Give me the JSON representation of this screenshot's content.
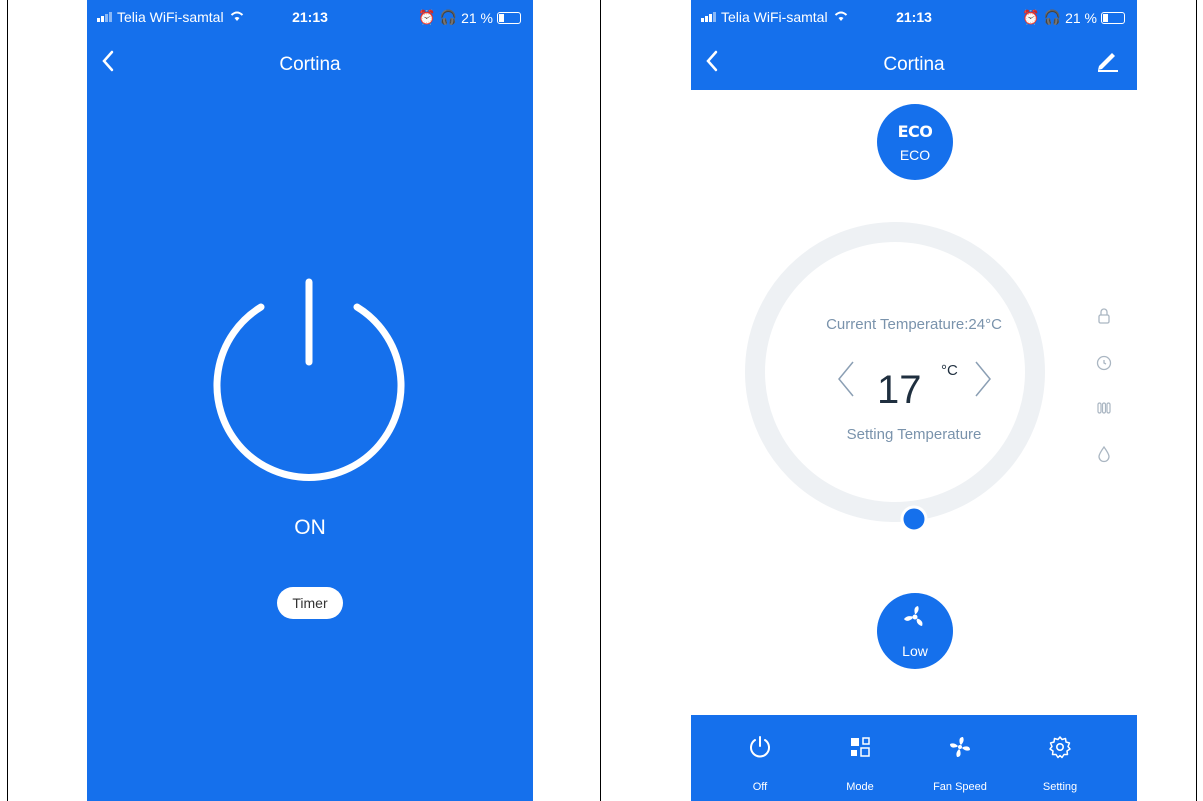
{
  "left_screen": {
    "status": {
      "carrier": "Telia WiFi-samtal",
      "time": "21:13",
      "battery": "21 %"
    },
    "title": "Cortina",
    "power_state": "ON",
    "timer_label": "Timer"
  },
  "right_screen": {
    "status": {
      "carrier": "Telia WiFi-samtal",
      "time": "21:13",
      "battery": "21 %"
    },
    "title": "Cortina",
    "eco": {
      "icon_text": "ECO",
      "label": "ECO"
    },
    "current_temp_label": "Current Temperature:24°C",
    "set_temp": "17",
    "unit": "°C",
    "setting_label": "Setting Temperature",
    "fan_label": "Low",
    "side_icons": [
      "lock-icon",
      "timer-icon",
      "heater-icon",
      "drop-icon"
    ],
    "tabs": [
      {
        "label": "Off",
        "icon": "power-icon"
      },
      {
        "label": "Mode",
        "icon": "mode-icon"
      },
      {
        "label": "Fan Speed",
        "icon": "fan-icon"
      },
      {
        "label": "Setting",
        "icon": "gear-icon"
      }
    ]
  },
  "colors": {
    "primary": "#1570EC",
    "ring": "#EEF1F4"
  }
}
